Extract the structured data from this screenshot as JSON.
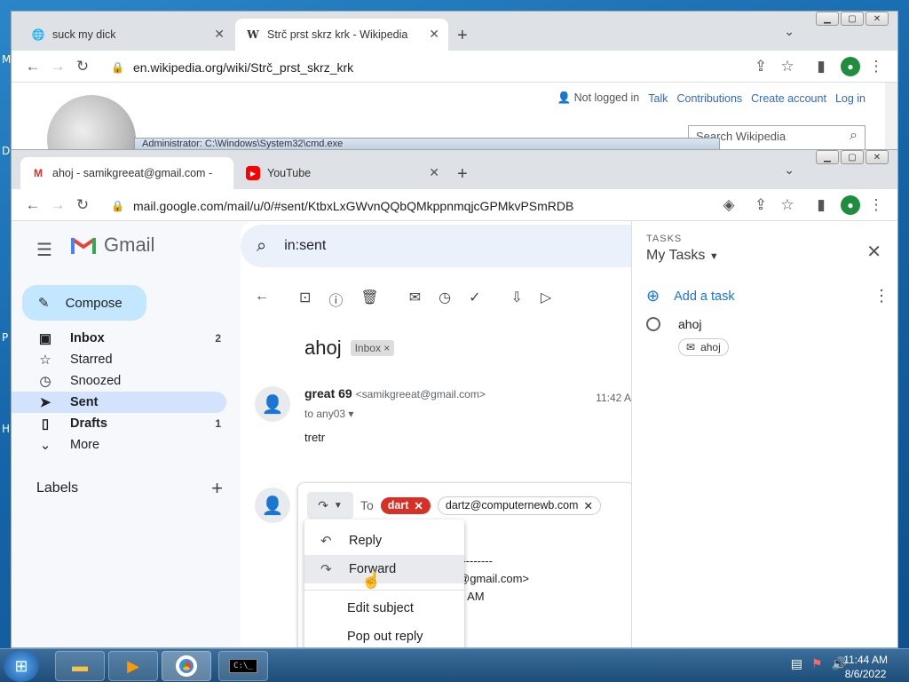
{
  "desktop": {
    "letters": [
      "M",
      "D",
      "P",
      "H"
    ]
  },
  "wiki_window": {
    "tabs": [
      {
        "title": "suck my dick",
        "favicon": "globe-icon"
      },
      {
        "title": "Strč prst skrz krk - Wikipedia",
        "favicon": "wikipedia-w-icon"
      }
    ],
    "url": "en.wikipedia.org/wiki/Strč_prst_skrz_krk",
    "user_links": {
      "status": "Not logged in",
      "talk": "Talk",
      "contributions": "Contributions",
      "create_account": "Create account",
      "log_in": "Log in"
    },
    "search_placeholder": "Search Wikipedia",
    "background_cmd_title": "Administrator: C:\\Windows\\System32\\cmd.exe"
  },
  "gmail_window": {
    "tabs": [
      {
        "title": "ahoj - samikgreeat@gmail.com -",
        "favicon": "gmail-icon"
      },
      {
        "title": "YouTube",
        "favicon": "youtube-icon"
      }
    ],
    "url": "mail.google.com/mail/u/0/#sent/KtbxLxGWvnQQbQMkppnmqjcGPMkvPSmRDB",
    "app_name": "Gmail",
    "compose_label": "Compose",
    "nav": [
      {
        "label": "Inbox",
        "count": "2",
        "icon": "inbox-icon",
        "bold": true
      },
      {
        "label": "Starred",
        "count": "",
        "icon": "star-icon",
        "bold": false
      },
      {
        "label": "Snoozed",
        "count": "",
        "icon": "clock-icon",
        "bold": false
      },
      {
        "label": "Sent",
        "count": "",
        "icon": "send-icon",
        "bold": true
      },
      {
        "label": "Drafts",
        "count": "1",
        "icon": "draft-icon",
        "bold": true
      },
      {
        "label": "More",
        "count": "",
        "icon": "chevron-down-icon",
        "bold": false
      }
    ],
    "labels_heading": "Labels",
    "search_query": "in:sent",
    "thread": {
      "subject": "ahoj",
      "label_chip": "Inbox",
      "message": {
        "sender": "great 69",
        "sender_email": "<samikgreeat@gmail.com>",
        "time": "11:42 A",
        "to": "to any03",
        "body": "tretr"
      },
      "reply": {
        "to_label": "To",
        "recipients": [
          "dart",
          "dartz@computernewb.com"
        ],
        "quoted_fragments": [
          "---------",
          "@gmail.com>",
          "2 AM"
        ]
      }
    },
    "reply_menu": {
      "items": [
        {
          "label": "Reply",
          "icon": "reply-icon",
          "highlighted": false
        },
        {
          "label": "Forward",
          "icon": "forward-icon",
          "highlighted": true
        },
        {
          "label": "Edit subject",
          "icon": "",
          "highlighted": false
        },
        {
          "label": "Pop out reply",
          "icon": "",
          "highlighted": false
        }
      ]
    },
    "tasks": {
      "panel_label": "TASKS",
      "list_name": "My Tasks",
      "add_label": "Add a task",
      "items": [
        {
          "title": "ahoj",
          "chip": "ahoj"
        }
      ]
    }
  },
  "taskbar": {
    "time": "11:44 AM",
    "date": "8/6/2022"
  }
}
